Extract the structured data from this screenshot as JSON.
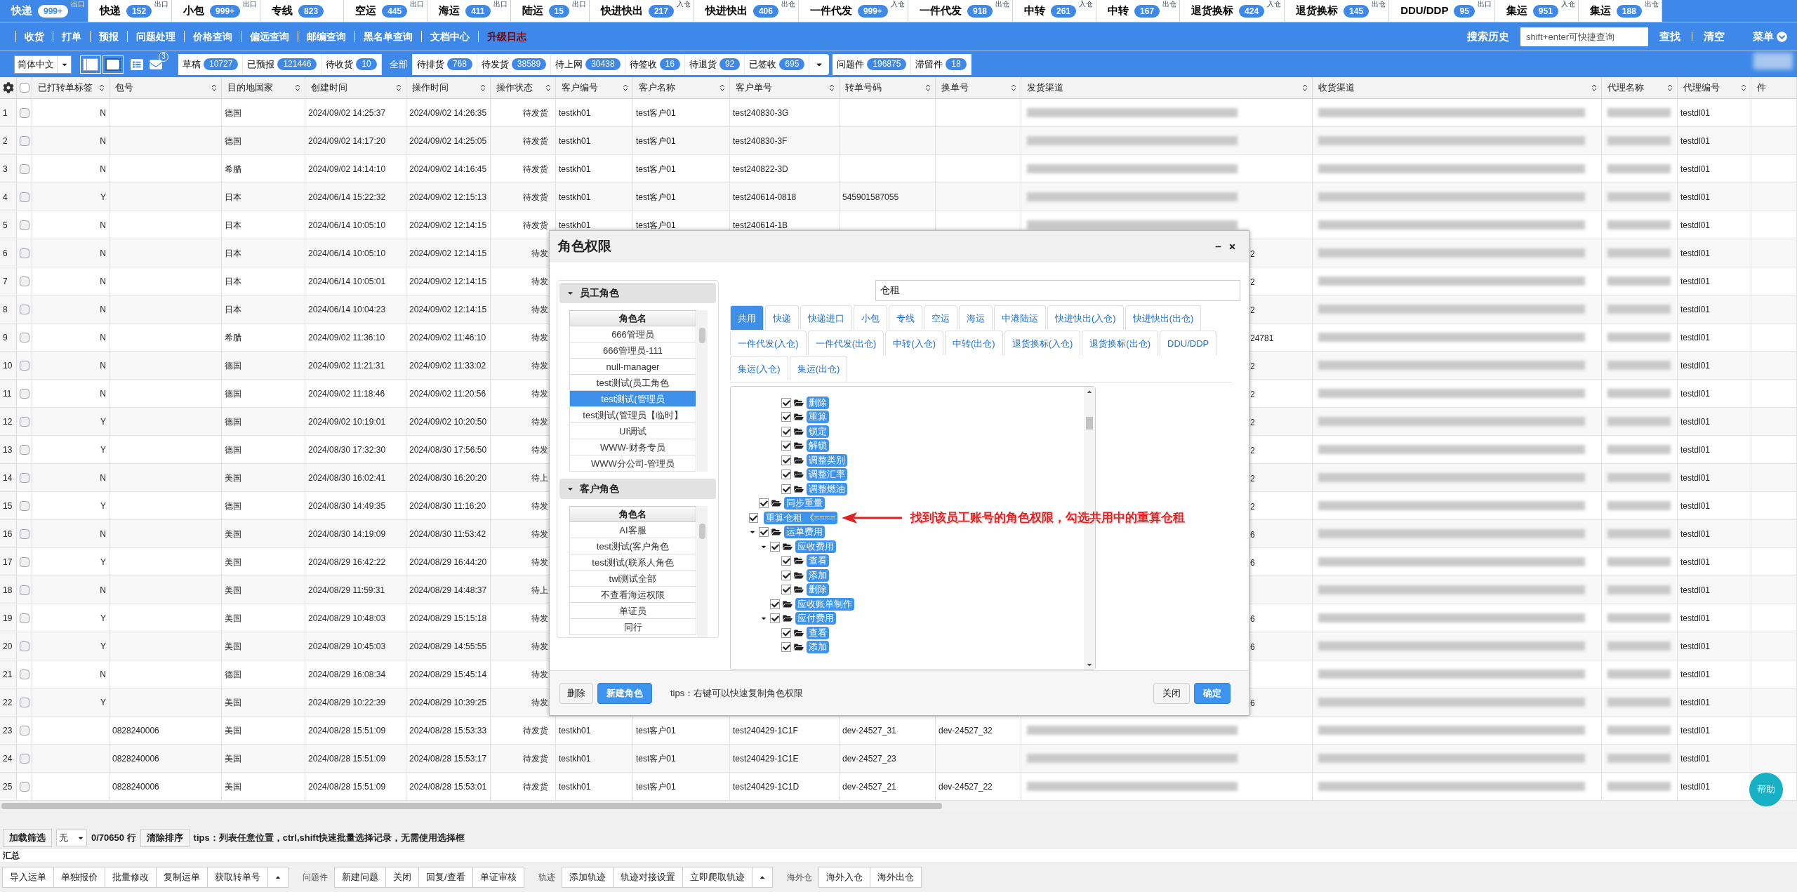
{
  "top_tabs": [
    {
      "label": "快递",
      "count": "999+",
      "sub": "出口",
      "selected": true
    },
    {
      "label": "快递",
      "count": "152",
      "sub": "出口",
      "selected": false
    },
    {
      "label": "小包",
      "count": "999+",
      "sub": "出口",
      "selected": false
    },
    {
      "label": "专线",
      "count": "823",
      "selected": false
    },
    {
      "label": "空运",
      "count": "445",
      "sub": "出口",
      "selected": false
    },
    {
      "label": "海运",
      "count": "411",
      "sub": "出口",
      "selected": false
    },
    {
      "label": "陆运",
      "count": "15",
      "sub": "出口",
      "selected": false
    },
    {
      "label": "快进快出",
      "count": "217",
      "sub": "入仓",
      "selected": false
    },
    {
      "label": "快进快出",
      "count": "406",
      "sub": "出仓",
      "selected": false
    },
    {
      "label": "一件代发",
      "count": "999+",
      "sub": "入仓",
      "selected": false
    },
    {
      "label": "一件代发",
      "count": "918",
      "sub": "出仓",
      "selected": false
    },
    {
      "label": "中转",
      "count": "261",
      "sub": "入仓",
      "selected": false
    },
    {
      "label": "中转",
      "count": "167",
      "sub": "出仓",
      "selected": false
    },
    {
      "label": "退货换标",
      "count": "424",
      "sub": "入仓",
      "selected": false
    },
    {
      "label": "退货换标",
      "count": "145",
      "sub": "出仓",
      "selected": false
    },
    {
      "label": "DDU/DDP",
      "count": "95",
      "sub": "出口",
      "selected": false
    },
    {
      "label": "集运",
      "count": "951",
      "sub": "入仓",
      "selected": false
    },
    {
      "label": "集运",
      "count": "188",
      "sub": "出仓",
      "selected": false
    }
  ],
  "nav": {
    "items": [
      {
        "label": "收货",
        "kind": "normal"
      },
      {
        "label": "打单",
        "kind": "normal"
      },
      {
        "label": "预报",
        "kind": "normal"
      },
      {
        "label": "问题处理",
        "kind": "normal"
      },
      {
        "label": "价格查询",
        "kind": "normal"
      },
      {
        "label": "偏远查询",
        "kind": "normal"
      },
      {
        "label": "邮编查询",
        "kind": "normal"
      },
      {
        "label": "黑名单查询",
        "kind": "normal"
      },
      {
        "label": "文档中心",
        "kind": "normal"
      },
      {
        "label": "升级日志",
        "kind": "highlight"
      }
    ],
    "search_history": "搜索历史",
    "search": {
      "placeholder": "shift+enter可快捷查询"
    },
    "find": "查找",
    "clear": "清空",
    "menu": "菜单"
  },
  "toolbar": {
    "language": "简体中文",
    "mail_badge": "3",
    "groups": [
      [
        {
          "label": "草稿",
          "count": "10727",
          "selected": false
        },
        {
          "label": "已预报",
          "count": "121446",
          "selected": false
        },
        {
          "label": "待收货",
          "count": "10",
          "selected": false
        }
      ],
      [
        {
          "label": "全部",
          "selected": true
        },
        {
          "label": "待排货",
          "count": "768",
          "selected": false
        },
        {
          "label": "待发货",
          "count": "38589",
          "selected": false
        },
        {
          "label": "待上网",
          "count": "30438",
          "selected": false
        },
        {
          "label": "待签收",
          "count": "16",
          "selected": false
        },
        {
          "label": "待退货",
          "count": "92",
          "selected": false
        },
        {
          "label": "已签收",
          "count": "695",
          "selected": false
        }
      ],
      [
        {
          "label": "问题件",
          "count": "196875",
          "selected": false
        },
        {
          "label": "滞留件",
          "count": "18",
          "selected": false
        }
      ]
    ]
  },
  "table": {
    "all_checked": false,
    "columns": [
      "已打转单标签",
      "包号",
      "目的地国家",
      "创建时间",
      "操作时间",
      "操作状态",
      "客户编号",
      "客户名称",
      "客户单号",
      "转单号码",
      "换单号",
      "发货渠道",
      "收货渠道",
      "代理名称",
      "代理编号",
      "件"
    ],
    "rows": [
      {
        "no": "1",
        "checked": false,
        "tag": "N",
        "country": "德国",
        "created": "2024/09/02 14:25:37",
        "operated": "2024/09/02 14:26:35",
        "status": "待发货",
        "cust_code": "testkh01",
        "cust_name": "test客户01",
        "cust_order": "test240830-3G",
        "agent_code": "testdl01"
      },
      {
        "no": "2",
        "checked": false,
        "tag": "N",
        "country": "德国",
        "created": "2024/09/02 14:17:20",
        "operated": "2024/09/02 14:25:05",
        "status": "待发货",
        "cust_code": "testkh01",
        "cust_name": "test客户01",
        "cust_order": "test240830-3F",
        "agent_code": "testdl01"
      },
      {
        "no": "3",
        "checked": false,
        "tag": "N",
        "country": "希腊",
        "created": "2024/09/02 14:14:10",
        "operated": "2024/09/02 14:16:45",
        "status": "待发货",
        "cust_code": "testkh01",
        "cust_name": "test客户01",
        "cust_order": "test240822-3D",
        "agent_code": "testdl01"
      },
      {
        "no": "4",
        "checked": false,
        "tag": "Y",
        "country": "日本",
        "created": "2024/06/14 15:22:32",
        "operated": "2024/09/02 12:15:13",
        "status": "待发货",
        "cust_code": "testkh01",
        "cust_name": "test客户01",
        "cust_order": "test240614-0818",
        "transfer_no": "545901587055",
        "agent_code": "testdl01"
      },
      {
        "no": "5",
        "checked": false,
        "tag": "N",
        "country": "日本",
        "created": "2024/06/14 10:05:10",
        "operated": "2024/09/02 12:14:15",
        "status": "待发货",
        "cust_code": "testkh01",
        "cust_name": "test客户01",
        "cust_order": "test240614-1B",
        "agent_code": "testdl01"
      },
      {
        "no": "6",
        "checked": false,
        "tag": "N",
        "country": "日本",
        "created": "2024/06/14 10:05:10",
        "operated": "2024/09/02 12:14:15",
        "status": "待发",
        "send_tail": "2",
        "agent_code": "testdl01"
      },
      {
        "no": "7",
        "checked": false,
        "tag": "N",
        "country": "日本",
        "created": "2024/06/14 10:05:01",
        "operated": "2024/09/02 12:14:15",
        "status": "待发",
        "send_tail": "2",
        "agent_code": "testdl01"
      },
      {
        "no": "8",
        "checked": false,
        "tag": "N",
        "country": "日本",
        "created": "2024/06/14 10:04:23",
        "operated": "2024/09/02 12:14:15",
        "status": "待发",
        "send_tail": "2",
        "agent_code": "testdl01"
      },
      {
        "no": "9",
        "checked": false,
        "tag": "N",
        "country": "希腊",
        "created": "2024/09/02 11:36:10",
        "operated": "2024/09/02 11:46:10",
        "status": "待发",
        "send_tail": "24781",
        "agent_code": "testdl01"
      },
      {
        "no": "10",
        "checked": false,
        "tag": "N",
        "country": "德国",
        "created": "2024/09/02 11:21:31",
        "operated": "2024/09/02 11:33:02",
        "status": "待发",
        "send_tail": "2",
        "agent_code": "testdl01"
      },
      {
        "no": "11",
        "checked": false,
        "tag": "N",
        "country": "德国",
        "created": "2024/09/02 11:18:46",
        "operated": "2024/09/02 11:20:56",
        "status": "待发",
        "send_tail": "2",
        "agent_code": "testdl01"
      },
      {
        "no": "12",
        "checked": false,
        "tag": "Y",
        "country": "德国",
        "created": "2024/09/02 10:19:01",
        "operated": "2024/09/02 10:20:50",
        "status": "待发",
        "send_tail": "2",
        "agent_code": "testdl01"
      },
      {
        "no": "13",
        "checked": false,
        "tag": "Y",
        "country": "德国",
        "created": "2024/08/30 17:32:30",
        "operated": "2024/08/30 17:56:50",
        "status": "待发",
        "send_tail": "2",
        "agent_code": "testdl01"
      },
      {
        "no": "14",
        "checked": false,
        "tag": "N",
        "country": "美国",
        "created": "2024/08/30 16:02:41",
        "operated": "2024/08/30 16:20:20",
        "status": "待上",
        "send_tail": "2",
        "agent_code": "testdl01"
      },
      {
        "no": "15",
        "checked": false,
        "tag": "Y",
        "country": "德国",
        "created": "2024/08/30 14:49:35",
        "operated": "2024/08/30 11:16:20",
        "status": "待发",
        "send_tail": "2",
        "agent_code": "testdl01"
      },
      {
        "no": "16",
        "checked": false,
        "tag": "N",
        "country": "美国",
        "created": "2024/08/30 14:19:09",
        "operated": "2024/08/30 11:53:42",
        "status": "待发",
        "send_tail": "6",
        "agent_code": "testdl01"
      },
      {
        "no": "17",
        "checked": false,
        "tag": "Y",
        "country": "美国",
        "created": "2024/08/29 16:42:22",
        "operated": "2024/08/29 16:44:20",
        "status": "待发",
        "send_tail": "6",
        "agent_code": "testdl01"
      },
      {
        "no": "18",
        "checked": false,
        "tag": "N",
        "country": "美国",
        "created": "2024/08/29 11:59:31",
        "operated": "2024/08/29 14:48:37",
        "status": "待上",
        "agent_code": "testdl01"
      },
      {
        "no": "19",
        "checked": false,
        "tag": "Y",
        "country": "美国",
        "created": "2024/08/29 10:48:03",
        "operated": "2024/08/29 15:15:18",
        "status": "待发",
        "send_tail": "6",
        "agent_code": "testdl01"
      },
      {
        "no": "20",
        "checked": false,
        "tag": "Y",
        "country": "美国",
        "created": "2024/08/29 10:45:03",
        "operated": "2024/08/29 14:55:55",
        "status": "待发",
        "send_tail": "6",
        "agent_code": "testdl01"
      },
      {
        "no": "21",
        "checked": false,
        "tag": "N",
        "country": "德国",
        "created": "2024/08/29 16:08:34",
        "operated": "2024/08/29 15:45:14",
        "status": "待发",
        "agent_code": "testdl01"
      },
      {
        "no": "22",
        "checked": false,
        "tag": "Y",
        "country": "美国",
        "created": "2024/08/29 10:22:39",
        "operated": "2024/08/29 10:39:25",
        "status": "待发",
        "send_tail": "6",
        "agent_code": "testdl01"
      },
      {
        "no": "23",
        "checked": false,
        "bag": "0828240006",
        "country": "美国",
        "created": "2024/08/28 15:51:09",
        "operated": "2024/08/28 15:53:33",
        "status": "待发货",
        "cust_code": "testkh01",
        "cust_name": "test客户01",
        "cust_order": "test240429-1C1F",
        "transfer_no": "dev-24527_31",
        "swap_no": "dev-24527_32",
        "agent_code": "testdl01"
      },
      {
        "no": "24",
        "checked": false,
        "bag": "0828240006",
        "country": "美国",
        "created": "2024/08/28 15:51:09",
        "operated": "2024/08/28 15:53:17",
        "status": "待发货",
        "cust_code": "testkh01",
        "cust_name": "test客户01",
        "cust_order": "test240429-1C1E",
        "transfer_no": "dev-24527_23",
        "agent_code": "testdl01"
      },
      {
        "no": "25",
        "checked": false,
        "bag": "0828240006",
        "country": "美国",
        "created": "2024/08/28 15:51:09",
        "operated": "2024/08/28 15:53:01",
        "status": "待发货",
        "cust_code": "testkh01",
        "cust_name": "test客户01",
        "cust_order": "test240429-1C1D",
        "transfer_no": "dev-24527_21",
        "swap_no": "dev-24527_22",
        "agent_code": "testdl01"
      }
    ]
  },
  "filter_bar": {
    "load_filter": "加载筛选",
    "filter_select": "无",
    "row_count": "0/70650 行",
    "clear_sort": "清除排序",
    "tips": "tips：列表任意位置，ctrl,shift快速批量选择记录，无需使用选择框"
  },
  "summary_label": "汇总",
  "action_bar": [
    {
      "kind": "button",
      "label": "导入运单"
    },
    {
      "kind": "button",
      "label": "单独报价"
    },
    {
      "kind": "button",
      "label": "批量修改"
    },
    {
      "kind": "button",
      "label": "复制运单"
    },
    {
      "kind": "button",
      "label": "获取转单号"
    },
    {
      "kind": "more"
    },
    {
      "kind": "label",
      "label": "问题件"
    },
    {
      "kind": "button",
      "label": "新建问题"
    },
    {
      "kind": "button",
      "label": "关闭"
    },
    {
      "kind": "button",
      "label": "回复/查看"
    },
    {
      "kind": "button",
      "label": "单证审核"
    },
    {
      "kind": "label",
      "label": "轨迹"
    },
    {
      "kind": "button",
      "label": "添加轨迹"
    },
    {
      "kind": "button",
      "label": "轨迹对接设置"
    },
    {
      "kind": "button",
      "label": "立即爬取轨迹"
    },
    {
      "kind": "more"
    },
    {
      "kind": "label",
      "label": "海外仓"
    },
    {
      "kind": "button",
      "label": "海外入仓"
    },
    {
      "kind": "button",
      "label": "海外出仓"
    }
  ],
  "help_button": "帮助",
  "dialog": {
    "title": "角色权限",
    "role_groups": [
      {
        "title": "员工角色",
        "expanded": true,
        "column": "角色名",
        "items": [
          {
            "label": "666管理员",
            "selected": false
          },
          {
            "label": "666管理员-111",
            "selected": false
          },
          {
            "label": "null-manager",
            "selected": false
          },
          {
            "label": "test测试(员工角色",
            "selected": false
          },
          {
            "label": "test测试(管理员",
            "selected": true
          },
          {
            "label": "test测试(管理员【临时】",
            "selected": false
          },
          {
            "label": "UI调试",
            "selected": false
          },
          {
            "label": "WWW-财务专员",
            "selected": false
          },
          {
            "label": "WWW分公司-管理员",
            "selected": false
          }
        ]
      },
      {
        "title": "客户角色",
        "expanded": true,
        "column": "角色名",
        "items": [
          {
            "label": "AI客服",
            "selected": false
          },
          {
            "label": "test测试(客户角色",
            "selected": false
          },
          {
            "label": "test测试(联系人角色",
            "selected": false
          },
          {
            "label": "twl测试全部",
            "selected": false
          },
          {
            "label": "不查看海运权限",
            "selected": false
          },
          {
            "label": "单证员",
            "selected": false
          },
          {
            "label": "同行",
            "selected": false
          }
        ]
      }
    ],
    "search": {
      "value": "仓租"
    },
    "tabs": [
      {
        "label": "共用",
        "selected": true
      },
      {
        "label": "快递",
        "selected": false
      },
      {
        "label": "快递进口",
        "selected": false
      },
      {
        "label": "小包",
        "selected": false
      },
      {
        "label": "专线",
        "selected": false
      },
      {
        "label": "空运",
        "selected": false
      },
      {
        "label": "海运",
        "selected": false
      },
      {
        "label": "中港陆运",
        "selected": false
      },
      {
        "label": "快进快出(入仓)",
        "selected": false
      },
      {
        "label": "快进快出(出仓)",
        "selected": false
      },
      {
        "label": "一件代发(入仓)",
        "selected": false
      },
      {
        "label": "一件代发(出仓)",
        "selected": false
      },
      {
        "label": "中转(入仓)",
        "selected": false
      },
      {
        "label": "中转(出仓)",
        "selected": false
      },
      {
        "label": "退货换标(入仓)",
        "selected": false
      },
      {
        "label": "退货换标(出仓)",
        "selected": false
      },
      {
        "label": "DDU/DDP",
        "selected": false
      },
      {
        "label": "集运(入仓)",
        "selected": false
      },
      {
        "label": "集运(出仓)",
        "selected": false
      }
    ],
    "tree": [
      {
        "children": [
          {
            "children": [
              {
                "label": "删除",
                "checked": true
              },
              {
                "label": "重算",
                "checked": true
              },
              {
                "label": "锁定",
                "checked": true
              },
              {
                "label": "解锁",
                "checked": true
              },
              {
                "label": "调整类别",
                "checked": true
              },
              {
                "label": "调整汇率",
                "checked": true
              },
              {
                "label": "调整燃油",
                "checked": true
              }
            ]
          }
        ]
      },
      {
        "label": "同步重量",
        "checked": true
      },
      {
        "label": "重算仓租 《====",
        "checked": true,
        "pointer": true
      },
      {
        "label": "运单费用",
        "checked": true,
        "expanded": true,
        "children": [
          {
            "label": "应收费用",
            "checked": true,
            "expanded": true,
            "children": [
              {
                "label": "查看",
                "checked": true
              },
              {
                "label": "添加",
                "checked": true
              },
              {
                "label": "删除",
                "checked": true
              }
            ]
          },
          {
            "label": "应收账单制作",
            "checked": true
          },
          {
            "label": "应付费用",
            "checked": true,
            "expanded": true,
            "children": [
              {
                "label": "查看",
                "checked": true
              },
              {
                "label": "添加",
                "checked": true
              }
            ]
          }
        ]
      }
    ],
    "annotation": "找到该员工账号的角色权限，勾选共用中的重算仓租",
    "delete_button": "删除",
    "new_button": "新建角色",
    "tips": "tips：右键可以快速复制角色权限",
    "close_button": "关闭",
    "ok_button": "确定"
  }
}
